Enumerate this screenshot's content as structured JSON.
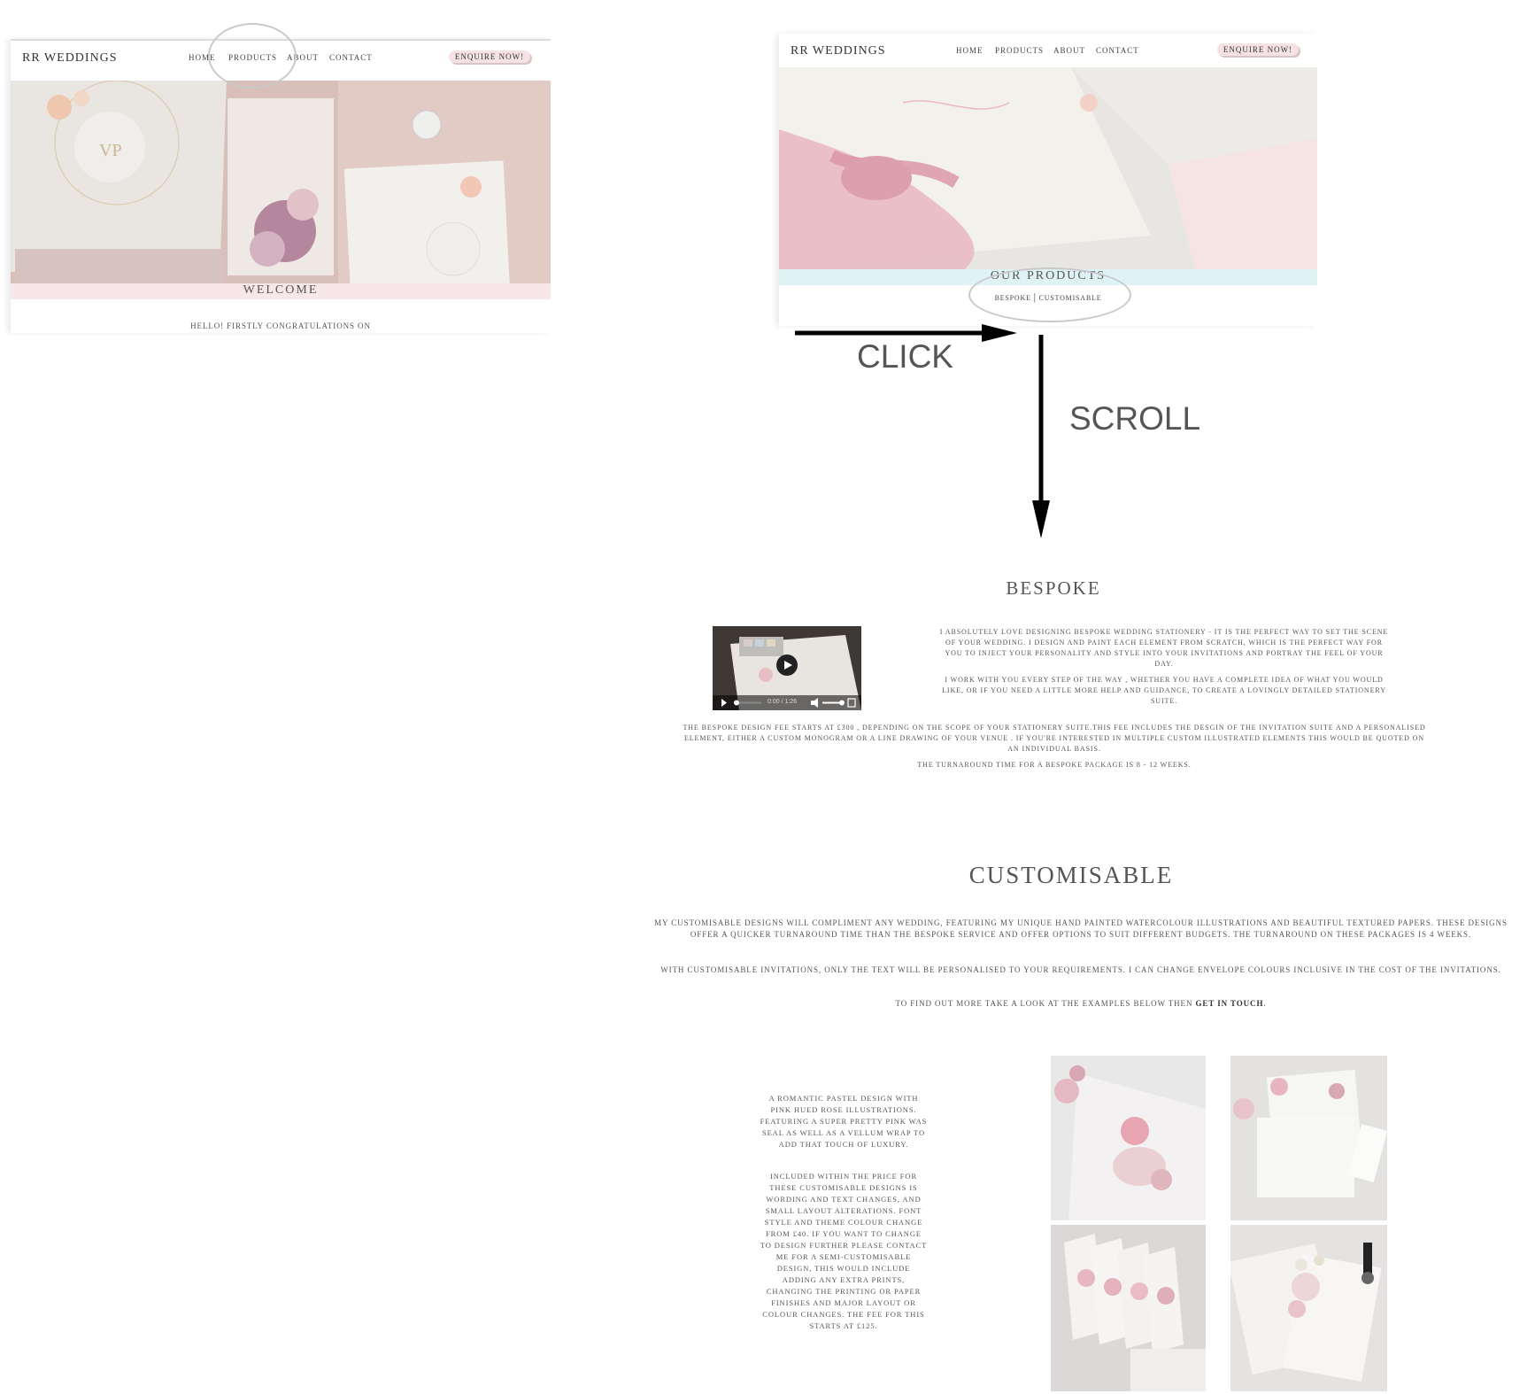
{
  "left_screen": {
    "logo": "RR WEDDINGS",
    "nav": [
      "HOME",
      "PRODUCTS",
      "ABOUT",
      "CONTACT"
    ],
    "enquire": "ENQUIRE NOW!",
    "welcome": "WELCOME",
    "intro_text": "HELLO! FIRSTLY CONGRATULATIONS ON"
  },
  "right_screen": {
    "logo": "RR WEDDINGS",
    "nav": [
      "HOME",
      "PRODUCTS",
      "ABOUT",
      "CONTACT"
    ],
    "enquire": "ENQUIRE NOW!",
    "our_products": "OUR PRODUCTS",
    "sub_links": {
      "bespoke": "BESPOKE",
      "separator": "|",
      "customisable": "CUSTOMISABLE"
    }
  },
  "annotations": {
    "click": "CLICK",
    "scroll": "SCROLL"
  },
  "bespoke": {
    "title": "BESPOKE",
    "video_time": "0:00 / 1:26",
    "para1": "I ABSOLUTELY LOVE DESIGNING BESPOKE WEDDING STATIONERY - IT IS THE PERFECT WAY TO SET THE SCENE OF YOUR WEDDING. I DESIGN AND PAINT EACH ELEMENT FROM SCRATCH, WHICH IS THE PERFECT WAY FOR YOU TO INJECT YOUR PERSONALITY AND STYLE INTO YOUR INVITATIONS AND PORTRAY THE FEEL OF YOUR DAY.",
    "para2": "I WORK WITH YOU EVERY STEP OF THE WAY , WHETHER YOU HAVE A COMPLETE IDEA OF WHAT YOU WOULD LIKE, OR IF YOU NEED A LITTLE MORE HELP AND GUIDANCE, TO CREATE A LOVINGLY DETAILED STATIONERY SUITE.",
    "para3": "THE BESPOKE DESIGN FEE STARTS AT £300 , DEPENDING ON THE SCOPE OF YOUR STATIONERY SUITE.THIS FEE INCLUDES THE DESGIN OF THE INVITATION SUITE AND A PERSONALISED ELEMENT, EITHER A CUSTOM MONOGRAM OR A LINE DRAWING OF YOUR VENUE . IF YOU'RE INTERESTED IN MULTIPLE CUSTOM ILLUSTRATED ELEMENTS THIS WOULD BE QUOTED ON AN INDIVIDUAL BASIS.",
    "para4": "THE TURNAROUND TIME FOR A BESPOKE PACKAGE IS 8 - 12 WEEKS."
  },
  "customisable": {
    "title": "CUSTOMISABLE",
    "para1": "MY CUSTOMISABLE DESIGNS WILL COMPLIMENT ANY WEDDING, FEATURING MY UNIQUE HAND PAINTED WATERCOLOUR ILLUSTRATIONS AND BEAUTIFUL TEXTURED PAPERS. THESE DESIGNS OFFER A QUICKER TURNAROUND TIME THAN THE BESPOKE SERVICE AND OFFER OPTIONS TO SUIT DIFFERENT BUDGETS. THE TURNAROUND ON THESE PACKAGES IS 4 WEEKS.",
    "para2": "WITH CUSTOMISABLE INVITATIONS, ONLY THE TEXT WILL BE PERSONALISED TO YOUR REQUIREMENTS. I CAN CHANGE ENVELOPE COLOURS INCLUSIVE IN THE COST OF THE INVITATIONS.",
    "para3_prefix": "TO FIND OUT MORE TAKE A LOOK AT THE EXAMPLES BELOW THEN",
    "para3_link": "GET IN TOUCH",
    "para3_suffix": ".",
    "side1": "A ROMANTIC PASTEL DESIGN WITH PINK HUED ROSE ILLUSTRATIONS. FEATURING A SUPER PRETTY PINK WAS SEAL AS WELL AS A VELLUM WRAP TO ADD THAT TOUCH OF LUXURY.",
    "side2": "INCLUDED WITHIN THE PRICE FOR THESE CUSTOMISABLE DESIGNS IS WORDING AND TEXT CHANGES, AND SMALL LAYOUT ALTERATIONS. FONT STYLE AND THEME COLOUR CHANGE FROM £40. IF YOU WANT TO CHANGE TO DESIGN FURTHER PLEASE CONTACT ME FOR A SEMI-CUSTOMISABLE DESIGN, THIS WOULD INCLUDE ADDING ANY EXTRA PRINTS, CHANGING THE PRINTING OR PAPER FINISHES AND MAJOR LAYOUT OR COLOUR CHANGES. THE FEE FOR THIS STARTS AT £125."
  },
  "colors": {
    "pink_bar": "#f8e7e8",
    "cyan_bar": "#dff3f5",
    "accent_pink": "#f6e1e4",
    "text": "#555555"
  }
}
